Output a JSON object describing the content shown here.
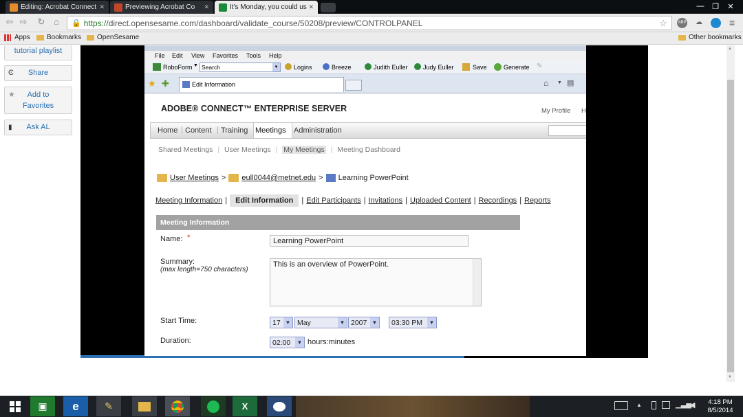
{
  "browser": {
    "tabs": [
      {
        "title": "Editing: Acrobat Connect"
      },
      {
        "title": "Previewing Acrobat Co"
      },
      {
        "title": "It's Monday, you could us"
      }
    ],
    "url_scheme": "https://",
    "url_rest": "direct.opensesame.com/dashboard/validate_course/50208/preview/CONTROLPANEL",
    "bookmarks": {
      "apps": "Apps",
      "bookmarks": "Bookmarks",
      "opensesame": "OpenSesame",
      "other": "Other bookmarks"
    }
  },
  "sidebar": {
    "playlist": "tutorial playlist",
    "share": "Share",
    "favorites": "Add to Favorites",
    "ask": "Ask AL"
  },
  "ie": {
    "menu": [
      "File",
      "Edit",
      "View",
      "Favorites",
      "Tools",
      "Help"
    ],
    "roboform": "RoboForm",
    "search": "Search",
    "logins": "Logins",
    "breeze": "Breeze",
    "user1": "Judith Euller",
    "user2": "Judy Euller",
    "save": "Save",
    "generate": "Generate",
    "tab_title": "Edit Information"
  },
  "connect": {
    "brand": "ADOBE® CONNECT™ ENTERPRISE SERVER",
    "my_profile": "My Profile",
    "profile_cut": "H",
    "nav": [
      "Home",
      "Content",
      "Training",
      "Meetings",
      "Administration"
    ],
    "subnav": [
      "Shared Meetings",
      "User Meetings",
      "My Meetings",
      "Meeting Dashboard"
    ],
    "breadcrumb": {
      "root": "User Meetings",
      "user": "eull0044@metnet.edu",
      "current": "Learning PowerPoint"
    },
    "tabs": [
      "Meeting Information",
      "Edit Information",
      "Edit Participants",
      "Invitations",
      "Uploaded Content",
      "Recordings",
      "Reports"
    ],
    "section": "Meeting Information",
    "name_label": "Name:",
    "name_required": "*",
    "name_value": "Learning PowerPoint",
    "summary_label": "Summary:",
    "summary_hint": "(max length=750 characters)",
    "summary_value": "This is an overview of PowerPoint.",
    "start_label": "Start Time:",
    "start_day": "17",
    "start_month": "May",
    "start_year": "2007",
    "start_time": "03:30 PM",
    "duration_label": "Duration:",
    "duration_value": "02:00",
    "duration_unit": "hours:minutes"
  },
  "taskbar": {
    "time": "4:18 PM",
    "date": "8/5/2014"
  }
}
